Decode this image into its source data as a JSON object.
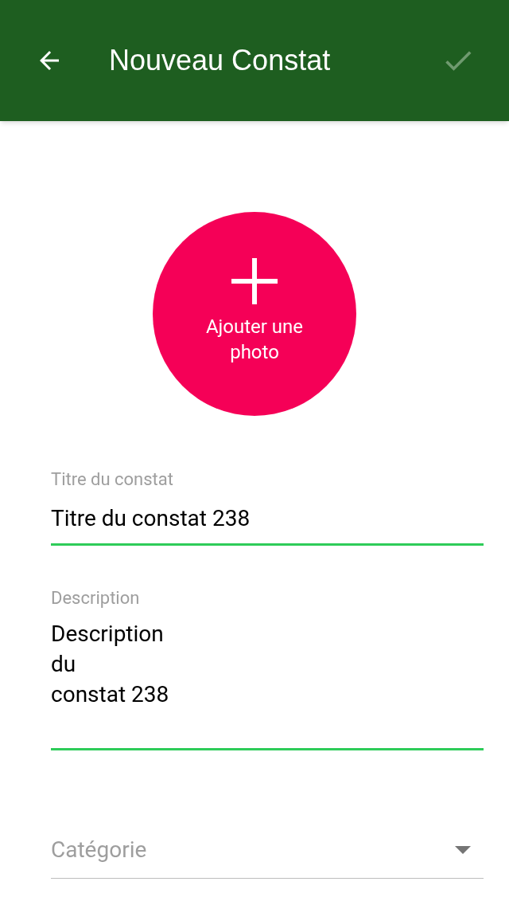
{
  "app_bar": {
    "title": "Nouveau Constat"
  },
  "photo_button": {
    "label": "Ajouter une photo"
  },
  "fields": [
    {
      "kind": "text",
      "label": "Titre du constat",
      "value": "Titre du constat 238"
    },
    {
      "kind": "multiline",
      "label": "Description",
      "value": "Description\ndu\nconstat 238"
    }
  ],
  "category": {
    "placeholder": "Catégorie"
  }
}
